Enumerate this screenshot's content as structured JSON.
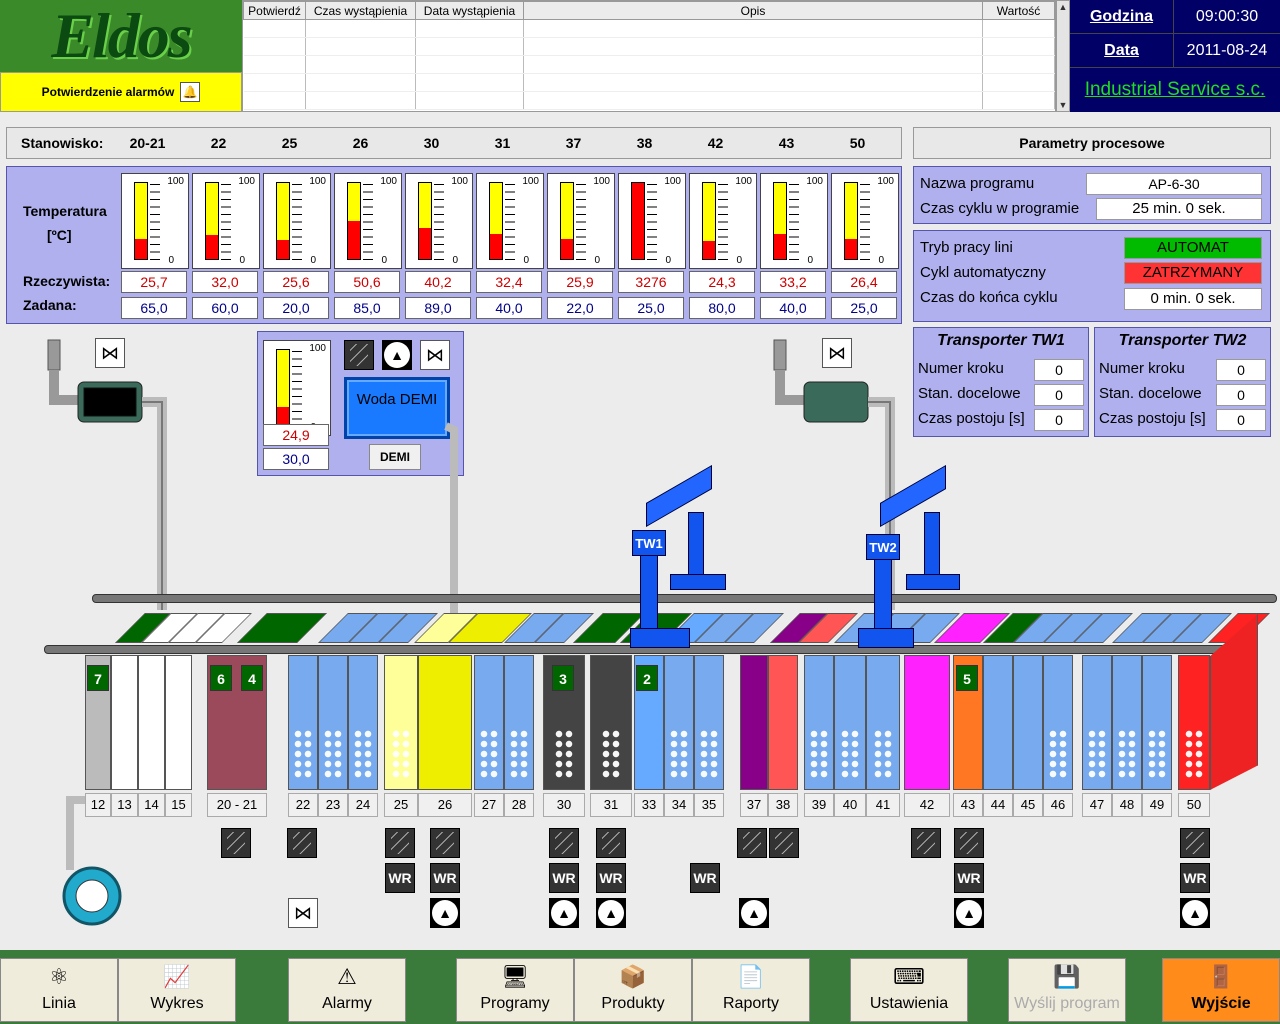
{
  "header": {
    "logo_text": "Eldos",
    "ack_label": "Potwierdzenie alarmów",
    "alarm_columns": [
      "Potwierdź",
      "Czas wystąpienia",
      "Data wystąpienia",
      "Opis",
      "Wartość"
    ],
    "time_label": "Godzina",
    "time_value": "09:00:30",
    "date_label": "Data",
    "date_value": "2011-08-24",
    "company": "Industrial Service s.c."
  },
  "stations": {
    "label": "Stanowisko:",
    "temperature_label": "Temperatura",
    "unit_label": "[ºC]",
    "actual_label": "Rzeczywista:",
    "setpoint_label": "Zadana:",
    "scale_max": "100",
    "scale_min": "0",
    "items": [
      {
        "name": "20-21",
        "actual": "25,7",
        "setpoint": "65,0",
        "level": 0.257
      },
      {
        "name": "22",
        "actual": "32,0",
        "setpoint": "60,0",
        "level": 0.32
      },
      {
        "name": "25",
        "actual": "25,6",
        "setpoint": "20,0",
        "level": 0.256
      },
      {
        "name": "26",
        "actual": "50,6",
        "setpoint": "85,0",
        "level": 0.506
      },
      {
        "name": "30",
        "actual": "40,2",
        "setpoint": "89,0",
        "level": 0.402
      },
      {
        "name": "31",
        "actual": "32,4",
        "setpoint": "40,0",
        "level": 0.324
      },
      {
        "name": "37",
        "actual": "25,9",
        "setpoint": "22,0",
        "level": 0.259
      },
      {
        "name": "38",
        "actual": "3276",
        "setpoint": "25,0",
        "level": 1.0
      },
      {
        "name": "42",
        "actual": "24,3",
        "setpoint": "80,0",
        "level": 0.243
      },
      {
        "name": "43",
        "actual": "33,2",
        "setpoint": "40,0",
        "level": 0.332
      },
      {
        "name": "50",
        "actual": "26,4",
        "setpoint": "25,0",
        "level": 0.264
      }
    ]
  },
  "params": {
    "title": "Parametry procesowe",
    "program_name_label": "Nazwa programu",
    "program_name": "AP-6-30",
    "cycle_time_label": "Czas cyklu w programie",
    "cycle_time": "25 min.  0  sek.",
    "mode_label": "Tryb pracy lini",
    "mode_value": "AUTOMAT",
    "auto_cycle_label": "Cykl automatyczny",
    "auto_cycle_value": "ZATRZYMANY",
    "remaining_label": "Czas do końca cyklu",
    "remaining_value": "0  min.  0  sek.",
    "colors": {
      "automat": "#00bb00",
      "stopped": "#ff3333"
    }
  },
  "transporters": [
    {
      "title": "Transporter TW1",
      "step_label": "Numer kroku",
      "step": "0",
      "target_label": "Stan. docelowe",
      "target": "0",
      "dwell_label": "Czas postoju [s]",
      "dwell": "0"
    },
    {
      "title": "Transporter TW2",
      "step_label": "Numer kroku",
      "step": "0",
      "target_label": "Stan. docelowe",
      "target": "0",
      "dwell_label": "Czas postoju [s]",
      "dwell": "0"
    }
  ],
  "demi": {
    "actual": "24,9",
    "setpoint": "30,0",
    "level": 0.249,
    "water_label": "Woda DEMI",
    "button_label": "DEMI"
  },
  "line": {
    "tw1_label": "TW1",
    "tw2_label": "TW2",
    "tank_numbers": [
      "12",
      "13",
      "14",
      "15",
      "20 - 21",
      "22",
      "23",
      "24",
      "25",
      "26",
      "27",
      "28",
      "30",
      "31",
      "33",
      "34",
      "35",
      "37",
      "38",
      "39",
      "40",
      "41",
      "42",
      "43",
      "44",
      "45",
      "46",
      "47",
      "48",
      "49",
      "50"
    ],
    "station_tags": [
      "7",
      "6",
      "4",
      "3",
      "2",
      "5"
    ],
    "wr_label": "WR"
  },
  "toolbar": {
    "buttons": [
      {
        "label": "Linia",
        "icon": "molecule-icon"
      },
      {
        "label": "Wykres",
        "icon": "chart-icon"
      },
      {
        "label": "Alarmy",
        "icon": "warning-icon"
      },
      {
        "label": "Programy",
        "icon": "program-icon"
      },
      {
        "label": "Produkty",
        "icon": "product-icon"
      },
      {
        "label": "Raporty",
        "icon": "report-icon"
      },
      {
        "label": "Ustawienia",
        "icon": "settings-icon"
      },
      {
        "label": "Wyślij program",
        "icon": "send-icon"
      },
      {
        "label": "Wyjście",
        "icon": "exit-icon"
      }
    ]
  }
}
